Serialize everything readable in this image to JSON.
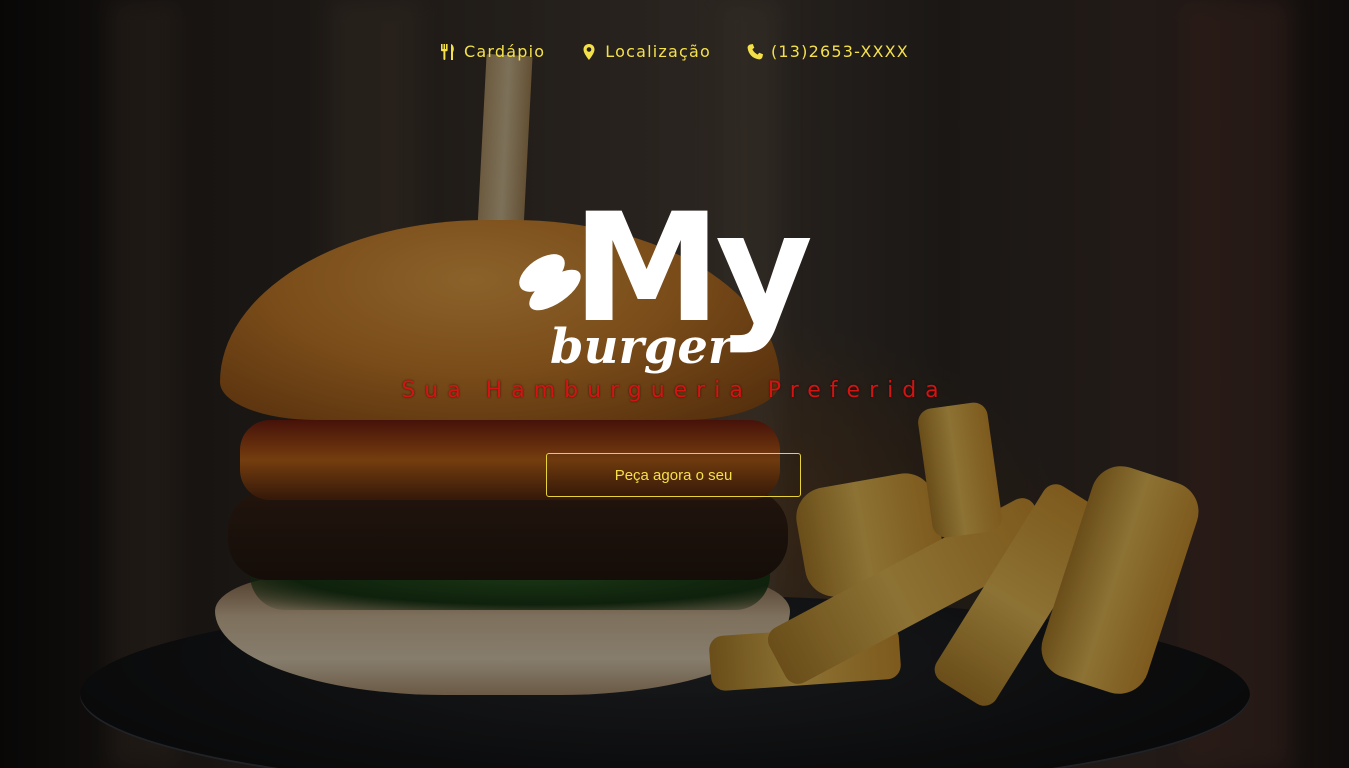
{
  "nav": {
    "items": [
      {
        "label": "Cardápio",
        "icon": "utensils-icon"
      },
      {
        "label": "Localização",
        "icon": "map-marker-icon"
      },
      {
        "label": "(13)2653-XXXX",
        "icon": "phone-icon"
      }
    ],
    "color": "#f4e04a"
  },
  "logo": {
    "top_text": "My",
    "bottom_text": "burger",
    "color": "#ffffff"
  },
  "hero": {
    "tagline": "Sua Hamburgueria Preferida",
    "tagline_color": "#d41313",
    "cta_label": "Peça agora o seu",
    "cta_color": "#f4e04a"
  }
}
